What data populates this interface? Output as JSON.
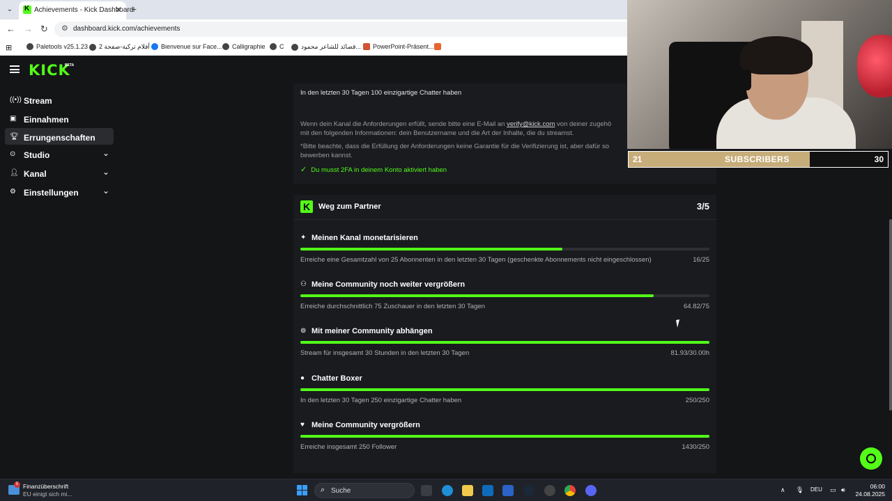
{
  "browser": {
    "tab_title": "Achievements - Kick Dashboard",
    "url": "dashboard.kick.com/achievements",
    "bookmarks": [
      "Paletools v25.1.23",
      "2 أفلام تركية-صفحة",
      "Bienvenue sur Face...",
      "Calligraphie",
      "C",
      "قصائد للشاعر محمود...",
      "PowerPoint-Präsent..."
    ]
  },
  "kick": {
    "logo": "KICK",
    "beta": "BETA"
  },
  "sidebar": {
    "items": [
      {
        "label": "Stream",
        "icon": "broadcast-icon"
      },
      {
        "label": "Einnahmen",
        "icon": "chart-icon"
      },
      {
        "label": "Errungenschaften",
        "icon": "trophy-icon"
      },
      {
        "label": "Studio",
        "icon": "studio-icon"
      },
      {
        "label": "Kanal",
        "icon": "person-icon"
      },
      {
        "label": "Einstellungen",
        "icon": "gear-icon"
      }
    ]
  },
  "verification": {
    "requirement": "In den letzten 30 Tagen 100 einzigartige Chatter haben",
    "desc_line1_pre": "Wenn dein Kanal die Anforderungen erfüllt, sende bitte eine E-Mail an ",
    "desc_email": "verify@kick.com",
    "desc_line1_post": " von deiner zugehö",
    "desc_line2": "mit den folgenden Informationen: dein Benutzername und die Art der Inhalte, die du streamst.",
    "note_line1": "*Bitte beachte, dass die Erfüllung der Anforderungen keine Garantie für die Verifizierung ist, aber dafür so",
    "note_line2": "bewerben kannst.",
    "twofa": "Du musst 2FA in deinem Konto aktiviert haben"
  },
  "partner": {
    "title": "Weg zum Partner",
    "count": "3/5",
    "achievements": [
      {
        "title": "Meinen Kanal monetarisieren",
        "icon": "sparkle-icon",
        "desc": "Erreiche eine Gesamtzahl von 25 Abonnenten in den letzten 30 Tagen (geschenkte Abonnements nicht eingeschlossen)",
        "value": "16/25",
        "progress": 0.64
      },
      {
        "title": "Meine Community noch weiter vergrößern",
        "icon": "users-icon",
        "desc": "Erreiche durchschnittlich 75 Zuschauer in den letzten 30 Tagen",
        "value": "64.82/75",
        "progress": 0.864
      },
      {
        "title": "Mit meiner Community abhängen",
        "icon": "broadcast-icon",
        "desc": "Stream für insgesamt 30 Stunden in den letzten 30 Tagen",
        "value": "81.93/30.00h",
        "progress": 1.0
      },
      {
        "title": "Chatter Boxer",
        "icon": "chat-icon",
        "desc": "In den letzten 30 Tagen 250 einzigartige Chatter haben",
        "value": "250/250",
        "progress": 1.0
      },
      {
        "title": "Meine Community vergrößern",
        "icon": "heart-icon",
        "desc": "Erreiche insgesamt 250 Follower",
        "value": "1430/250",
        "progress": 1.0
      }
    ]
  },
  "overlay": {
    "sub_left": "21",
    "sub_label": "SUBSCRIBERS",
    "sub_right": "30",
    "sub_progress": 0.7
  },
  "taskbar": {
    "weather_title": "Finanzüberschrift",
    "weather_sub": "EU einigt sich mi...",
    "weather_badge": "5",
    "search": "Suche",
    "lang": "DEU",
    "time": "06:00",
    "date": "24.08.2025"
  },
  "colors": {
    "accent": "#53fc18",
    "background": "#141517",
    "card": "#191b1f"
  }
}
